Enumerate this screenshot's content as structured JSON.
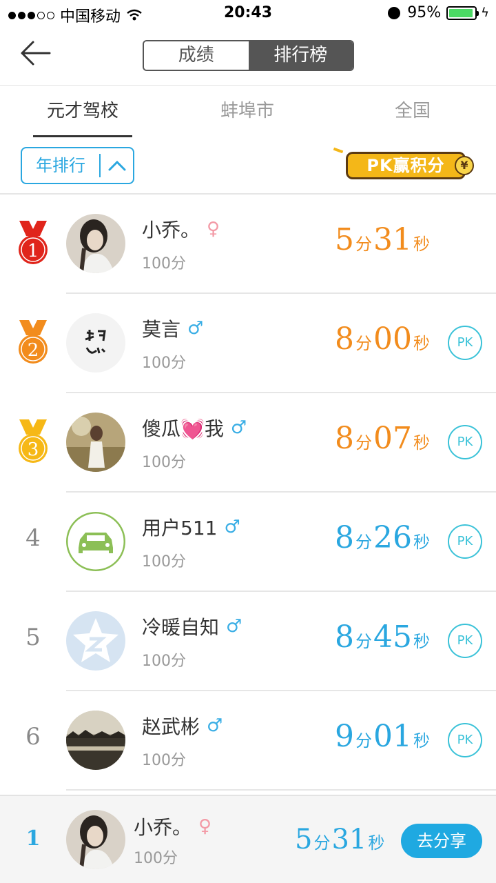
{
  "status_bar": {
    "carrier": "中国移动",
    "time": "20:43",
    "battery": "95%"
  },
  "nav": {
    "segments": [
      "成绩",
      "排行榜"
    ],
    "active_segment": 1
  },
  "tabs": [
    "元才驾校",
    "蚌埠市",
    "全国"
  ],
  "filter": {
    "label": "年排行"
  },
  "pk_badge": {
    "text": "PK赢积分",
    "coin": "¥"
  },
  "units": {
    "min": "分",
    "sec": "秒"
  },
  "pk_label": "PK",
  "rows": [
    {
      "rank": "1",
      "name": "小乔。",
      "gender": "♀",
      "score": "100分",
      "min": "5",
      "sec": "31",
      "pk": false
    },
    {
      "rank": "2",
      "name": "莫言",
      "gender": "♂",
      "score": "100分",
      "min": "8",
      "sec": "00",
      "pk": true
    },
    {
      "rank": "3",
      "name": "傻瓜💓我",
      "gender": "♂",
      "score": "100分",
      "min": "8",
      "sec": "07",
      "pk": true
    },
    {
      "rank": "4",
      "name": "用户511",
      "gender": "♂",
      "score": "100分",
      "min": "8",
      "sec": "26",
      "pk": true
    },
    {
      "rank": "5",
      "name": "冷暖自知",
      "gender": "♂",
      "score": "100分",
      "min": "8",
      "sec": "45",
      "pk": true
    },
    {
      "rank": "6",
      "name": "赵武彬",
      "gender": "♂",
      "score": "100分",
      "min": "9",
      "sec": "01",
      "pk": true
    }
  ],
  "colors": {
    "gold_medal": "#f6b816",
    "silver_medal": "#f28c1d",
    "first_medal": "#e0251b",
    "accent": "#2aa7e0",
    "time_top": "#f28c1d"
  },
  "footer": {
    "rank": "1",
    "name": "小乔。",
    "gender": "♀",
    "score": "100分",
    "min": "5",
    "sec": "31",
    "share_label": "去分享"
  }
}
